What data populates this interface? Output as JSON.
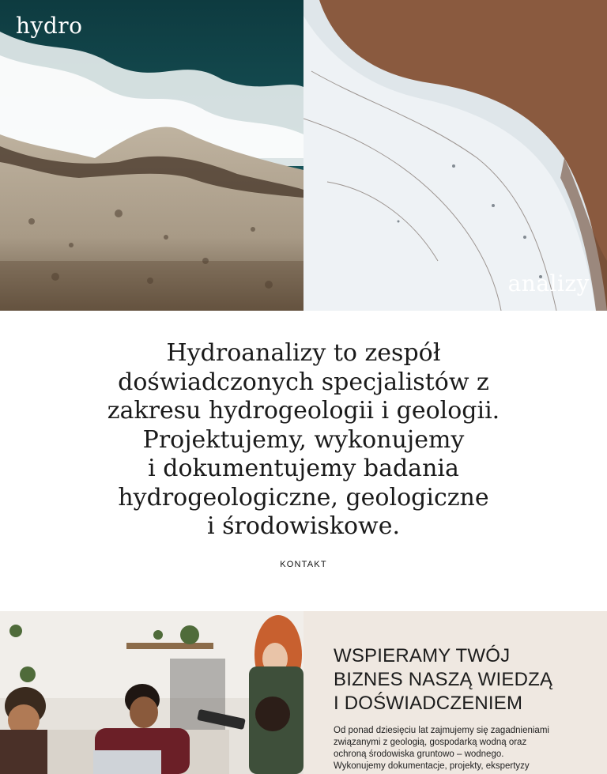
{
  "hero": {
    "brand_left": "hydro",
    "brand_right": "analizy"
  },
  "intro": {
    "lines": [
      "Hydroanalizy to zespół",
      "doświadczonych specjalistów z",
      "zakresu hydrogeologii i geologii.",
      "Projektujemy, wykonujemy",
      "i dokumentujemy badania",
      "hydrogeologiczne, geologiczne",
      "i środowiskowe."
    ],
    "contact_label": "KONTAKT"
  },
  "support": {
    "heading_lines": [
      "WSPIERAMY TWÓJ",
      "BIZNES NASZĄ WIEDZĄ",
      "I DOŚWIADCZENIEM"
    ],
    "body_lines": [
      "Od ponad dziesięciu lat zajmujemy się zagadnieniami",
      "związanymi z geologią, gospodarką wodną oraz",
      "ochroną środowiska gruntowo – wodnego.",
      "Wykonujemy dokumentacje, projekty, ekspertyzy"
    ]
  },
  "colors": {
    "beige_panel": "#efe8e1",
    "text_dark": "#1a1a1a"
  }
}
